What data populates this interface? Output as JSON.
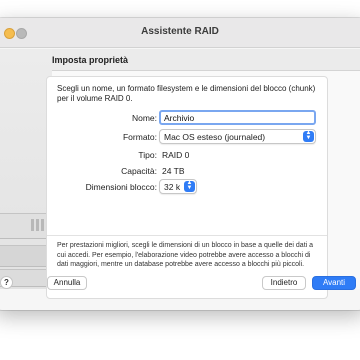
{
  "window": {
    "title": "Assistente RAID"
  },
  "section": {
    "title": "Imposta proprietà"
  },
  "intro": "Scegli un nome, un formato filesystem e le dimensioni del blocco (chunk) per il volume RAID 0.",
  "form": {
    "name_label": "Nome:",
    "name_value": "Archivio",
    "format_label": "Formato:",
    "format_value": "Mac OS esteso (journaled)",
    "type_label": "Tipo:",
    "type_value": "RAID 0",
    "capacity_label": "Capacità:",
    "capacity_value": "24 TB",
    "block_label": "Dimensioni blocco:",
    "block_value": "32 k"
  },
  "note": "Per prestazioni migliori, scegli le dimensioni di un blocco in base a quelle dei dati a cui accedi. Per esempio, l'elaborazione video potrebbe avere accesso a blocchi di dati maggiori, mentre un database potrebbe avere accesso a blocchi più piccoli.",
  "buttons": {
    "help": "?",
    "cancel": "Annulla",
    "back": "Indietro",
    "next": "Avanti"
  },
  "colors": {
    "accent": "#2f7cf6",
    "focus_ring": "#7aa7f0"
  },
  "icons": {
    "stepper": "chevron-up-down-icon"
  }
}
